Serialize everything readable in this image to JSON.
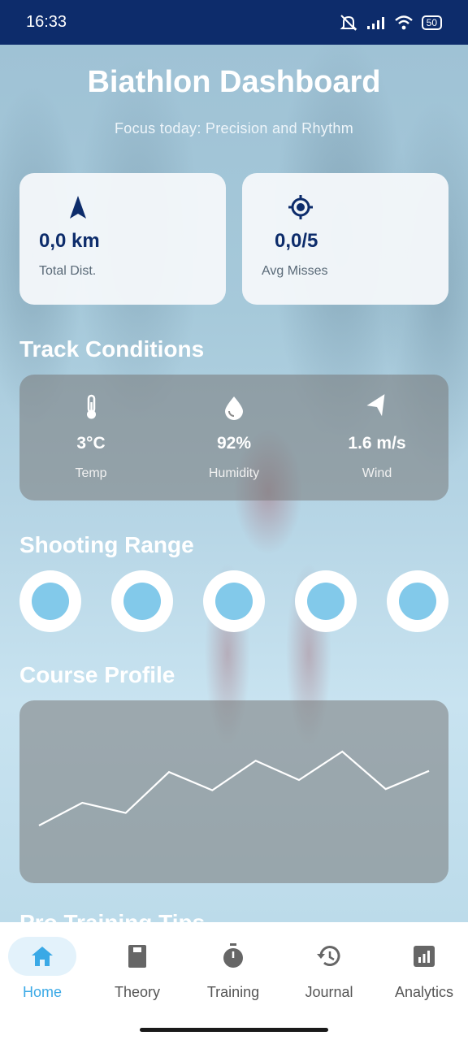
{
  "status": {
    "time": "16:33",
    "battery": "50"
  },
  "header": {
    "title": "Biathlon Dashboard",
    "subtitle": "Focus today: Precision and Rhythm"
  },
  "stats": [
    {
      "icon": "navigation-arrow-icon",
      "value": "0,0 km",
      "label": "Total Dist."
    },
    {
      "icon": "crosshair-icon",
      "value": "0,0/5",
      "label": "Avg Misses"
    }
  ],
  "track_conditions": {
    "title": "Track Conditions",
    "items": [
      {
        "icon": "thermometer-icon",
        "value": "3°C",
        "label": "Temp"
      },
      {
        "icon": "water-drop-icon",
        "value": "92%",
        "label": "Humidity"
      },
      {
        "icon": "wind-arrow-icon",
        "value": "1.6 m/s",
        "label": "Wind"
      }
    ]
  },
  "shooting_range": {
    "title": "Shooting Range",
    "targets": 5
  },
  "course_profile": {
    "title": "Course Profile",
    "points": [
      [
        0,
        0.15
      ],
      [
        1,
        0.35
      ],
      [
        2,
        0.26
      ],
      [
        3,
        0.62
      ],
      [
        4,
        0.46
      ],
      [
        5,
        0.72
      ],
      [
        6,
        0.55
      ],
      [
        7,
        0.8
      ],
      [
        8,
        0.47
      ],
      [
        9,
        0.63
      ]
    ]
  },
  "next_section_peek": "Pro Training Tips",
  "colors": {
    "accent": "#3aa9e6",
    "navy": "#0d2c6b",
    "hit": "#82c9ea"
  },
  "nav": [
    {
      "icon": "home-icon",
      "label": "Home",
      "active": true
    },
    {
      "icon": "book-icon",
      "label": "Theory"
    },
    {
      "icon": "stopwatch-icon",
      "label": "Training"
    },
    {
      "icon": "history-icon",
      "label": "Journal"
    },
    {
      "icon": "bar-chart-icon",
      "label": "Analytics"
    }
  ]
}
